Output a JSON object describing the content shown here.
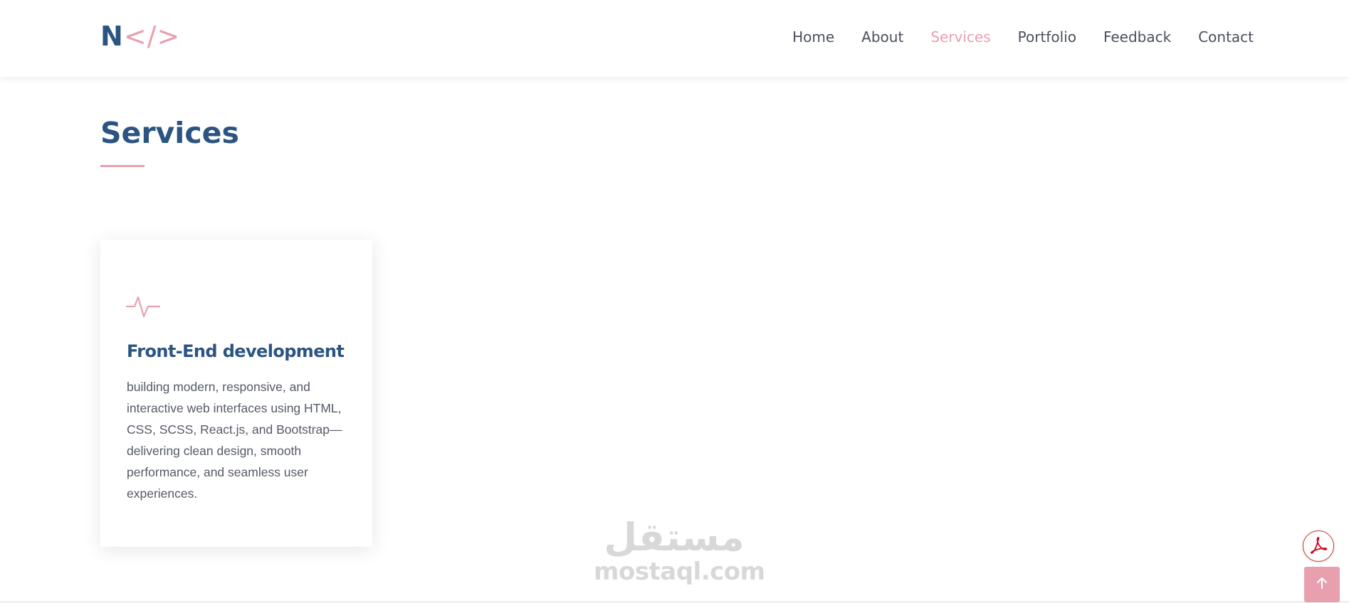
{
  "header": {
    "logo": {
      "letter": "N",
      "code": "</>"
    },
    "nav": [
      {
        "label": "Home",
        "active": false
      },
      {
        "label": "About",
        "active": false
      },
      {
        "label": "Services",
        "active": true
      },
      {
        "label": "Portfolio",
        "active": false
      },
      {
        "label": "Feedback",
        "active": false
      },
      {
        "label": "Contact",
        "active": false
      }
    ]
  },
  "section": {
    "title": "Services"
  },
  "cards": [
    {
      "icon": "pulse-icon",
      "title": "Front-End development",
      "text": "building modern, responsive, and interactive web interfaces using HTML, CSS, SCSS, React.js, and Bootstrap—delivering clean design, smooth performance, and seamless user experiences."
    }
  ],
  "watermark": {
    "arabic": "مستقل",
    "latin": "mostaql.com"
  },
  "floating": {
    "pdf_icon": "acrobat-icon",
    "top_icon": "arrow-up-icon"
  },
  "colors": {
    "brand_blue": "#2b5482",
    "accent_pink": "#e8a0ae",
    "text_gray": "#555a66",
    "pdf_red": "#c0392b"
  }
}
